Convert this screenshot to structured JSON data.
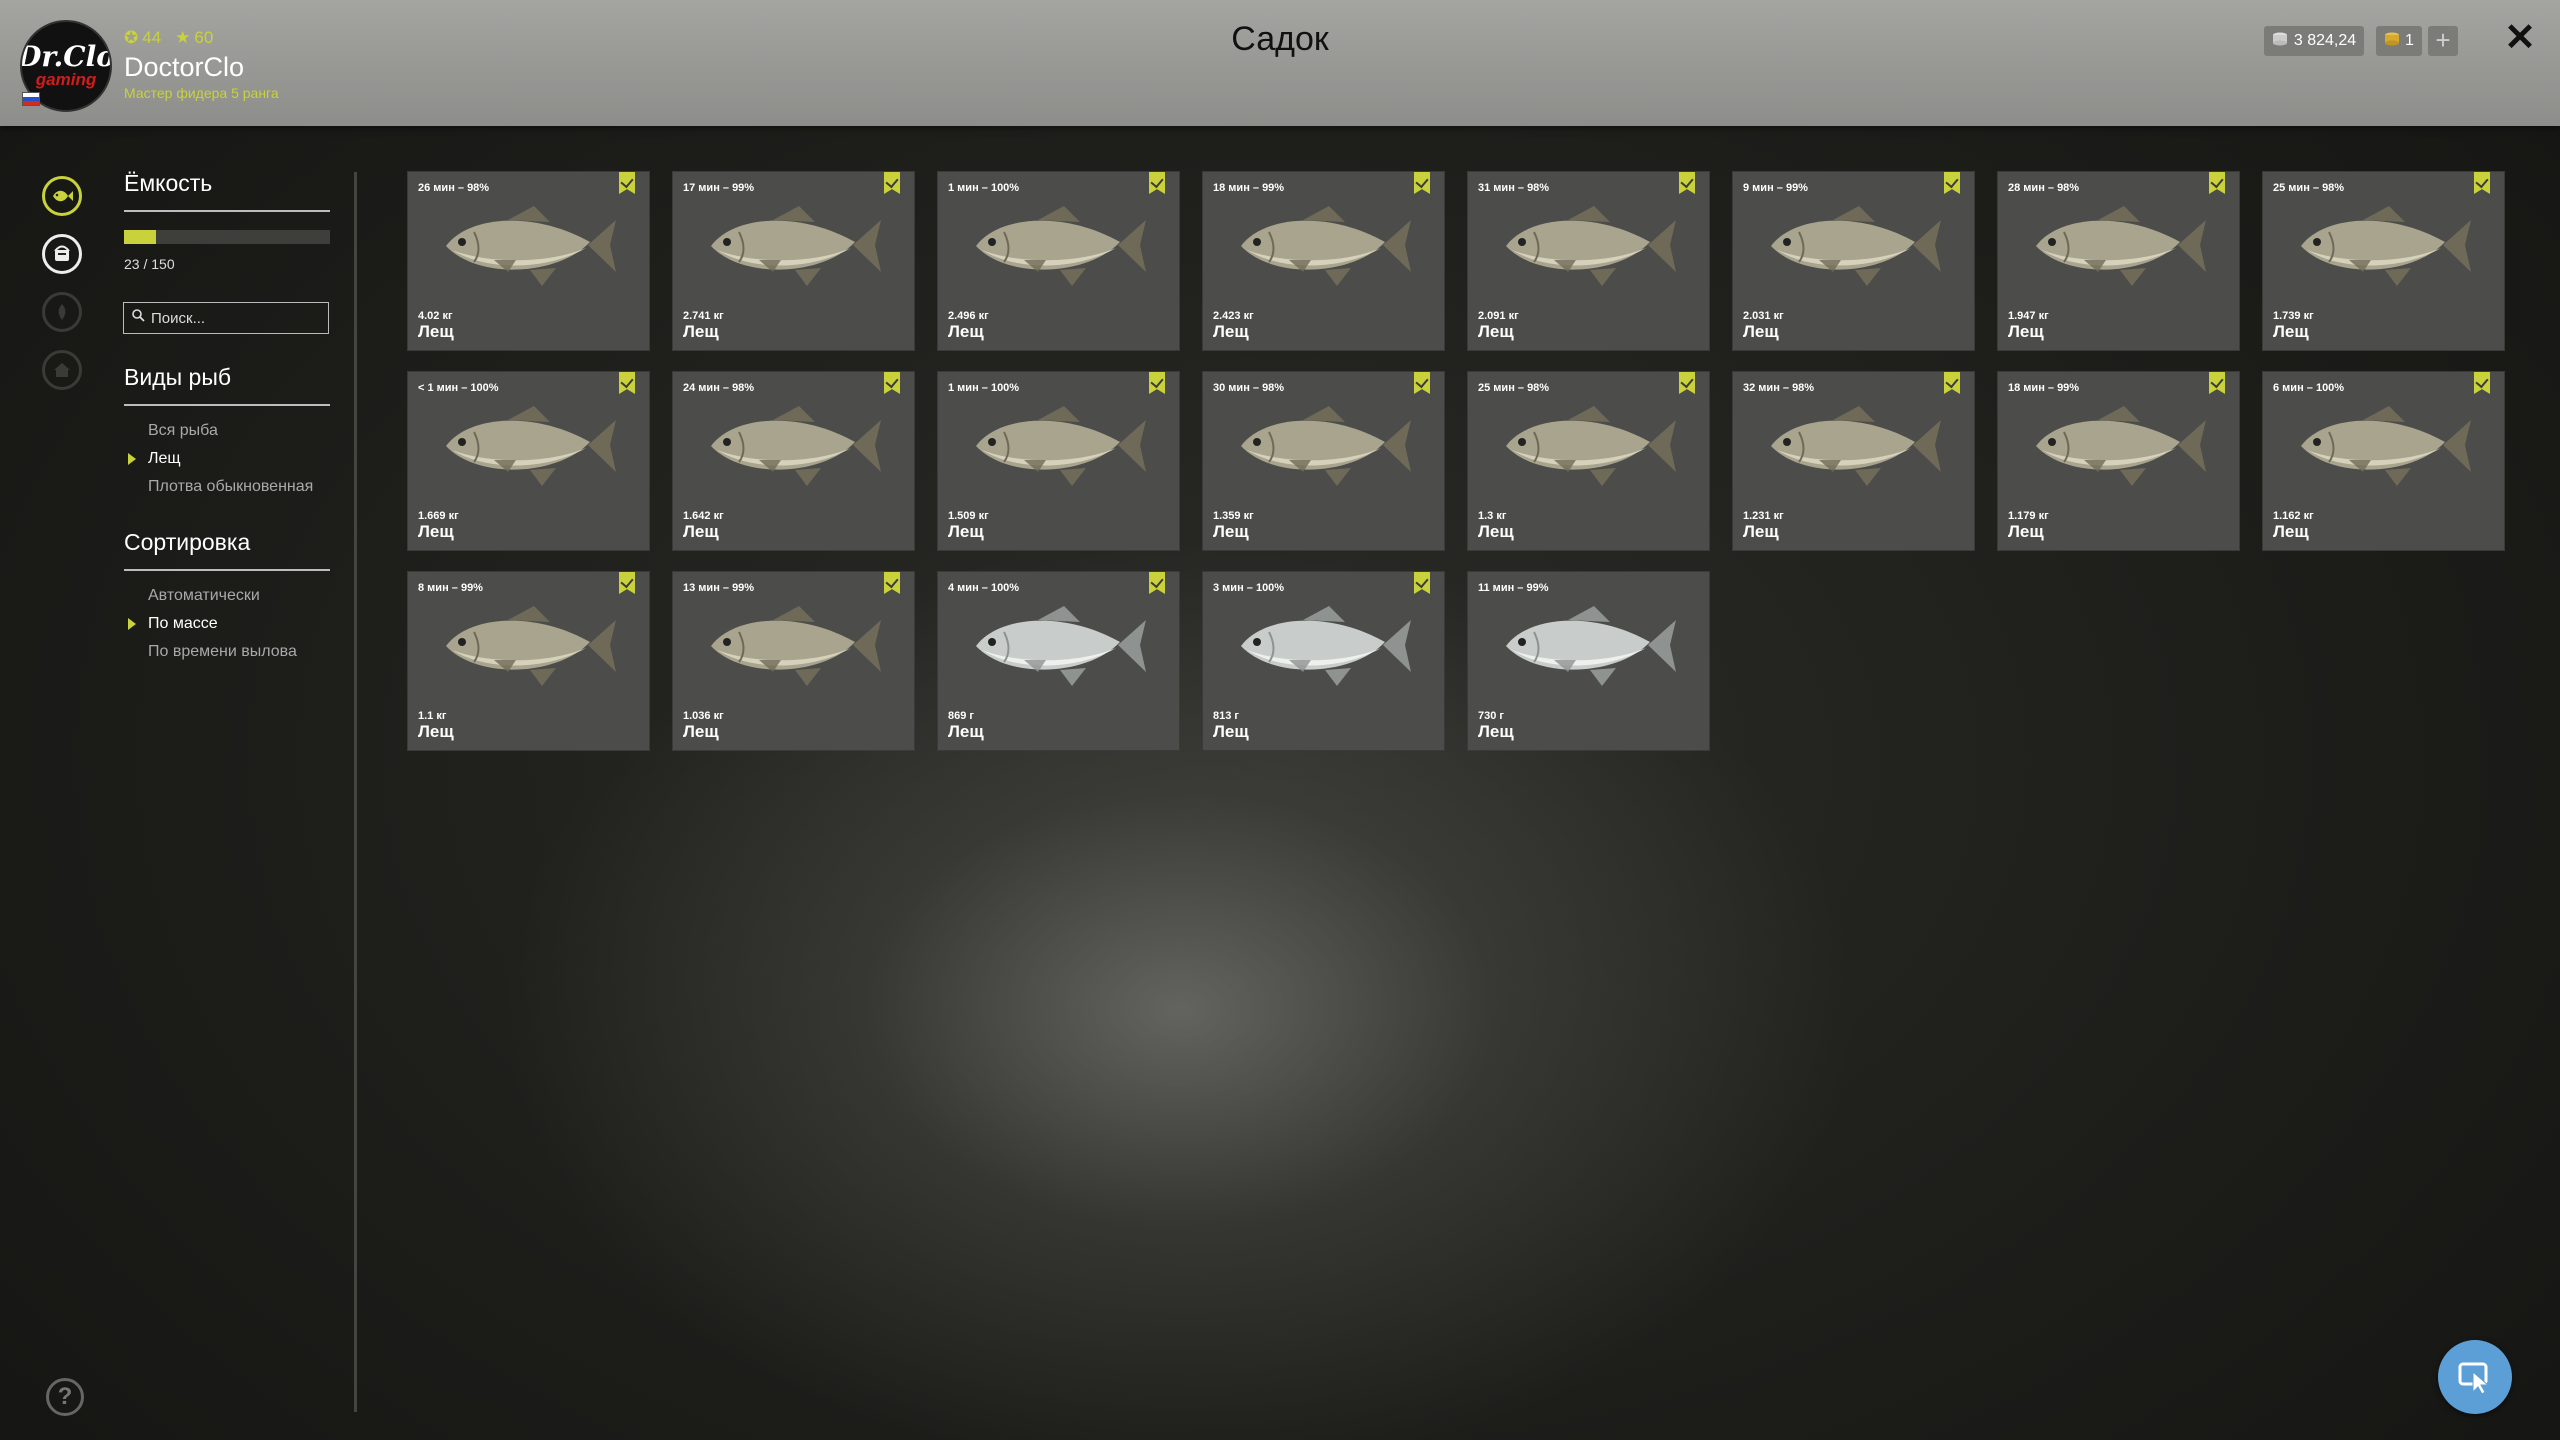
{
  "header": {
    "title": "Садок",
    "user": {
      "name": "DoctorClo",
      "rank": "Мастер фидера 5 ранга",
      "level": "44",
      "stars": "60",
      "avatar_line1": "Dr.Clo",
      "avatar_line2": "gaming"
    },
    "currency": {
      "silver": "3 824,24",
      "gold": "1",
      "add": "+"
    },
    "close": "✕"
  },
  "sidebar": {
    "capacity_title": "Ёмкость",
    "capacity_text": "23 / 150",
    "capacity_fraction": 0.1533,
    "search_placeholder": "Поиск...",
    "species_title": "Виды рыб",
    "species": [
      {
        "label": "Вся рыба",
        "selected": false
      },
      {
        "label": "Лещ",
        "selected": true
      },
      {
        "label": "Плотва обыкновенная",
        "selected": false
      }
    ],
    "sort_title": "Сортировка",
    "sort": [
      {
        "label": "Автоматически",
        "selected": false
      },
      {
        "label": "По массе",
        "selected": true
      },
      {
        "label": "По времени вылова",
        "selected": false
      }
    ]
  },
  "fish": [
    {
      "time": "26 мин – 98%",
      "weight": "4.02 кг",
      "name": "Лещ",
      "marked": true,
      "variant": "bream"
    },
    {
      "time": "17 мин – 99%",
      "weight": "2.741 кг",
      "name": "Лещ",
      "marked": true,
      "variant": "bream"
    },
    {
      "time": "1 мин – 100%",
      "weight": "2.496 кг",
      "name": "Лещ",
      "marked": true,
      "variant": "bream"
    },
    {
      "time": "18 мин – 99%",
      "weight": "2.423 кг",
      "name": "Лещ",
      "marked": true,
      "variant": "bream"
    },
    {
      "time": "31 мин – 98%",
      "weight": "2.091 кг",
      "name": "Лещ",
      "marked": true,
      "variant": "bream"
    },
    {
      "time": "9 мин – 99%",
      "weight": "2.031 кг",
      "name": "Лещ",
      "marked": true,
      "variant": "bream"
    },
    {
      "time": "28 мин – 98%",
      "weight": "1.947 кг",
      "name": "Лещ",
      "marked": true,
      "variant": "bream"
    },
    {
      "time": "25 мин – 98%",
      "weight": "1.739 кг",
      "name": "Лещ",
      "marked": true,
      "variant": "bream"
    },
    {
      "time": "< 1 мин – 100%",
      "weight": "1.669 кг",
      "name": "Лещ",
      "marked": true,
      "variant": "bream"
    },
    {
      "time": "24 мин – 98%",
      "weight": "1.642 кг",
      "name": "Лещ",
      "marked": true,
      "variant": "bream"
    },
    {
      "time": "1 мин – 100%",
      "weight": "1.509 кг",
      "name": "Лещ",
      "marked": true,
      "variant": "bream"
    },
    {
      "time": "30 мин – 98%",
      "weight": "1.359 кг",
      "name": "Лещ",
      "marked": true,
      "variant": "bream"
    },
    {
      "time": "25 мин – 98%",
      "weight": "1.3 кг",
      "name": "Лещ",
      "marked": true,
      "variant": "bream"
    },
    {
      "time": "32 мин – 98%",
      "weight": "1.231 кг",
      "name": "Лещ",
      "marked": true,
      "variant": "bream"
    },
    {
      "time": "18 мин – 99%",
      "weight": "1.179 кг",
      "name": "Лещ",
      "marked": true,
      "variant": "bream"
    },
    {
      "time": "6 мин – 100%",
      "weight": "1.162 кг",
      "name": "Лещ",
      "marked": true,
      "variant": "bream"
    },
    {
      "time": "8 мин – 99%",
      "weight": "1.1 кг",
      "name": "Лещ",
      "marked": true,
      "variant": "bream"
    },
    {
      "time": "13 мин – 99%",
      "weight": "1.036 кг",
      "name": "Лещ",
      "marked": true,
      "variant": "bream"
    },
    {
      "time": "4 мин – 100%",
      "weight": "869 г",
      "name": "Лещ",
      "marked": true,
      "variant": "silver"
    },
    {
      "time": "3 мин – 100%",
      "weight": "813 г",
      "name": "Лещ",
      "marked": true,
      "variant": "silver"
    },
    {
      "time": "11 мин – 99%",
      "weight": "730 г",
      "name": "Лещ",
      "marked": false,
      "variant": "silver"
    }
  ],
  "colors": {
    "accent": "#c9d23b",
    "bream_body": "#a8a48e",
    "silver_body": "#c8ccca"
  }
}
